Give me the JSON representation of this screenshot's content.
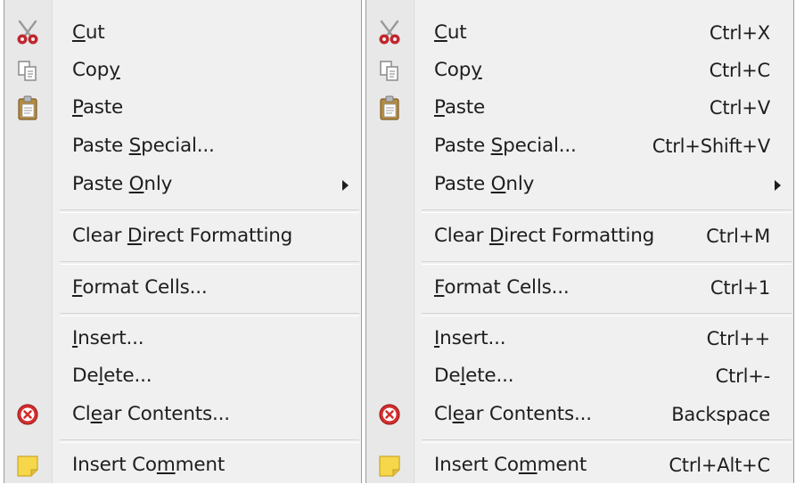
{
  "menus": [
    {
      "items": [
        {
          "id": "cut",
          "pre": "",
          "key": "C",
          "post": "ut",
          "shortcut": "",
          "icon": "scissors-icon"
        },
        {
          "id": "copy",
          "pre": "Cop",
          "key": "y",
          "post": "",
          "shortcut": "",
          "icon": "copy-icon"
        },
        {
          "id": "paste",
          "pre": "",
          "key": "P",
          "post": "aste",
          "shortcut": "",
          "icon": "clipboard-icon"
        },
        {
          "id": "paste-special",
          "pre": "Paste ",
          "key": "S",
          "post": "pecial...",
          "shortcut": "",
          "icon": ""
        },
        {
          "id": "paste-only",
          "pre": "Paste ",
          "key": "O",
          "post": "nly",
          "shortcut": "",
          "icon": "",
          "submenu": true
        },
        {
          "id": "clear-direct-formatting",
          "pre": "Clear ",
          "key": "D",
          "post": "irect Formatting",
          "shortcut": "",
          "icon": ""
        },
        {
          "id": "format-cells",
          "pre": "",
          "key": "F",
          "post": "ormat Cells...",
          "shortcut": "",
          "icon": ""
        },
        {
          "id": "insert",
          "pre": "",
          "key": "I",
          "post": "nsert...",
          "shortcut": "",
          "icon": ""
        },
        {
          "id": "delete",
          "pre": "De",
          "key": "l",
          "post": "ete...",
          "shortcut": "",
          "icon": ""
        },
        {
          "id": "clear-contents",
          "pre": "Cl",
          "key": "e",
          "post": "ar Contents...",
          "shortcut": "",
          "icon": "clear-circle-icon"
        },
        {
          "id": "insert-comment",
          "pre": "Insert Co",
          "key": "m",
          "post": "ment",
          "shortcut": "",
          "icon": "sticky-note-icon"
        }
      ]
    },
    {
      "items": [
        {
          "id": "cut",
          "pre": "",
          "key": "C",
          "post": "ut",
          "shortcut": "Ctrl+X",
          "icon": "scissors-icon"
        },
        {
          "id": "copy",
          "pre": "Cop",
          "key": "y",
          "post": "",
          "shortcut": "Ctrl+C",
          "icon": "copy-icon"
        },
        {
          "id": "paste",
          "pre": "",
          "key": "P",
          "post": "aste",
          "shortcut": "Ctrl+V",
          "icon": "clipboard-icon"
        },
        {
          "id": "paste-special",
          "pre": "Paste ",
          "key": "S",
          "post": "pecial...",
          "shortcut": "Ctrl+Shift+V",
          "icon": ""
        },
        {
          "id": "paste-only",
          "pre": "Paste ",
          "key": "O",
          "post": "nly",
          "shortcut": "",
          "icon": "",
          "submenu": true
        },
        {
          "id": "clear-direct-formatting",
          "pre": "Clear ",
          "key": "D",
          "post": "irect Formatting",
          "shortcut": "Ctrl+M",
          "icon": ""
        },
        {
          "id": "format-cells",
          "pre": "",
          "key": "F",
          "post": "ormat Cells...",
          "shortcut": "Ctrl+1",
          "icon": ""
        },
        {
          "id": "insert",
          "pre": "",
          "key": "I",
          "post": "nsert...",
          "shortcut": "Ctrl++",
          "icon": ""
        },
        {
          "id": "delete",
          "pre": "De",
          "key": "l",
          "post": "ete...",
          "shortcut": "Ctrl+-",
          "icon": ""
        },
        {
          "id": "clear-contents",
          "pre": "Cl",
          "key": "e",
          "post": "ar Contents...",
          "shortcut": "Backspace",
          "icon": "clear-circle-icon"
        },
        {
          "id": "insert-comment",
          "pre": "Insert Co",
          "key": "m",
          "post": "ment",
          "shortcut": "Ctrl+Alt+C",
          "icon": "sticky-note-icon"
        }
      ]
    }
  ],
  "colors": {
    "menu_background": "#f0f0f0",
    "gutter": "#e8e8e8",
    "text": "#1e1e1e",
    "scissors_handle": "#c0282f",
    "clear_icon": "#d32f2f",
    "note_icon": "#f6d74a"
  }
}
